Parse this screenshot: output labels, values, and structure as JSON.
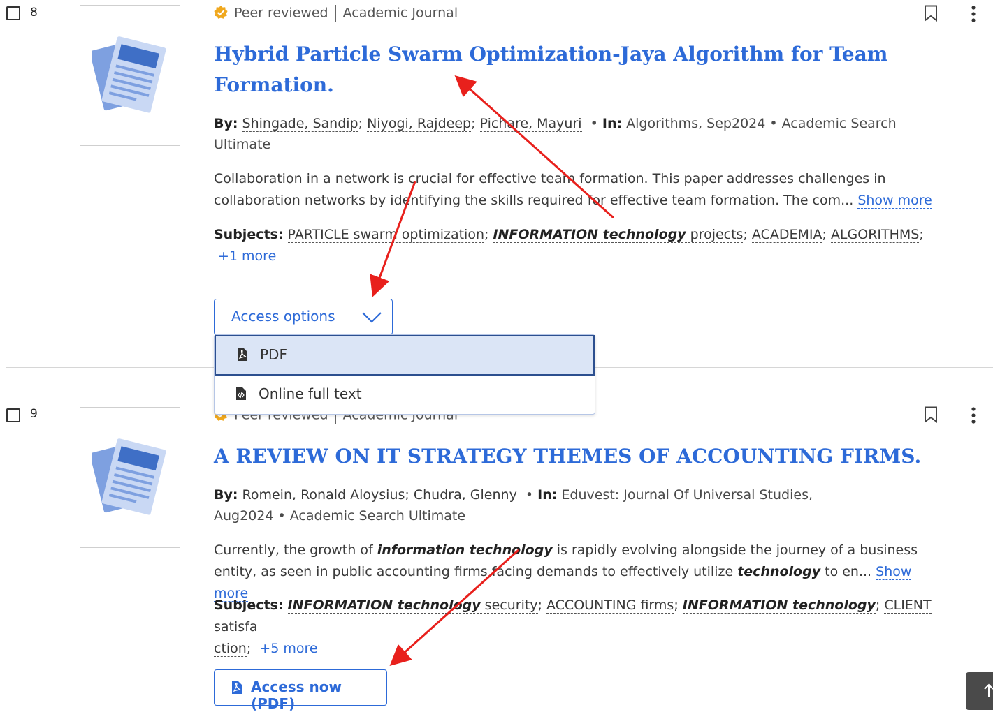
{
  "results": [
    {
      "number": "8",
      "peer_label": "Peer reviewed",
      "type_label": "Academic Journal",
      "title_line1": "Hybrid Particle Swarm Optimization-Jaya Algorithm for Team",
      "title_line2": "Formation.",
      "by_label": "By:",
      "authors": [
        "Shingade, Sandip",
        "Niyogi, Rajdeep",
        "Pichare, Mayuri"
      ],
      "in_label": "In:",
      "source_line1": "Algorithms, Sep2024 • Academic Search",
      "source_line2": "Ultimate",
      "abstract_line1": "Collaboration in a network is crucial for effective team formation. This paper addresses challenges in",
      "abstract_line2": "collaboration networks by identifying the skills required for effective team formation. The com...",
      "show_more": "Show more",
      "subjects_label": "Subjects:",
      "subject_1": "PARTICLE swarm optimization",
      "subject_2_em": "INFORMATION technology",
      "subject_2_rest": " projects",
      "subject_3": "ACADEMIA",
      "subject_4": "ALGORITHMS",
      "more_subjects": "+1 more",
      "access_options": "Access options",
      "dropdown_items": [
        "PDF",
        "Online full text"
      ]
    },
    {
      "number": "9",
      "peer_label": "Peer reviewed",
      "type_label": "Academic Journal",
      "title_line1": "A REVIEW ON IT STRATEGY THEMES OF ACCOUNTING FIRMS.",
      "by_label": "By:",
      "authors": [
        "Romein, Ronald Aloysius",
        "Chudra, Glenny"
      ],
      "in_label": "In:",
      "source_line1": "Eduvest: Journal Of Universal Studies,",
      "source_line2": "Aug2024 • Academic Search Ultimate",
      "abstract_pre": "Currently, the growth of ",
      "abstract_em1": "information technology",
      "abstract_mid": " is rapidly evolving alongside the journey of a business",
      "abstract_line2_pre": "entity, as seen in public accounting firms facing demands to effectively utilize ",
      "abstract_em2": "technology",
      "abstract_line2_post": " to en...",
      "show_more": "Show more",
      "subjects_label": "Subjects:",
      "subject_1_em": "INFORMATION technology",
      "subject_1_rest": " security",
      "subject_2": "ACCOUNTING firms",
      "subject_3_em": "INFORMATION technology",
      "subject_4_a": "CLIENT satisfa",
      "subject_4_b": "ction",
      "more_subjects": "+5 more",
      "access_now": "Access now (PDF)"
    }
  ],
  "colors": {
    "link_blue": "#2d6ad8",
    "annotation_red": "#e8201c",
    "badge_orange": "#f0a81e",
    "selected_bg": "#dbe5f6"
  },
  "icons": [
    "checkbox-icon",
    "peer-reviewed-badge-icon",
    "document-thumbnail-icon",
    "bookmark-icon",
    "more-vertical-icon",
    "chevron-down-icon",
    "pdf-file-icon",
    "html-file-icon",
    "arrow-up-icon"
  ]
}
